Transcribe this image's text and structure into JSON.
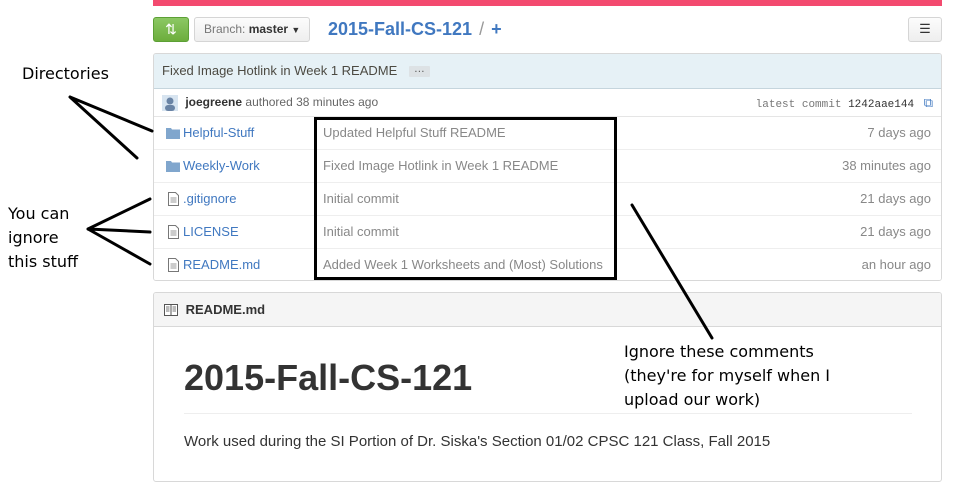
{
  "branch": {
    "label": "Branch:",
    "name": "master"
  },
  "repo": {
    "name": "2015-Fall-CS-121",
    "separator": "/",
    "add": "+"
  },
  "commit": {
    "title": "Fixed Image Hotlink in Week 1 README",
    "ellipsis": "…",
    "author": "joegreene",
    "authored_text": "authored 38 minutes ago",
    "latest_label": "latest commit",
    "sha": "1242aae144"
  },
  "files": [
    {
      "type": "dir",
      "name": "Helpful-Stuff",
      "message": "Updated Helpful Stuff README",
      "age": "7 days ago"
    },
    {
      "type": "dir",
      "name": "Weekly-Work",
      "message": "Fixed Image Hotlink in Week 1 README",
      "age": "38 minutes ago"
    },
    {
      "type": "file",
      "name": ".gitignore",
      "message": "Initial commit",
      "age": "21 days ago"
    },
    {
      "type": "file",
      "name": "LICENSE",
      "message": "Initial commit",
      "age": "21 days ago"
    },
    {
      "type": "file",
      "name": "README.md",
      "message": "Added Week 1 Worksheets and (Most) Solutions",
      "age": "an hour ago"
    }
  ],
  "readme": {
    "filename": "README.md",
    "heading": "2015-Fall-CS-121",
    "paragraph": "Work used during the SI Portion of Dr. Siska's Section 01/02 CPSC 121 Class, Fall 2015"
  },
  "annotations": {
    "directories": "Directories",
    "ignore_stuff": [
      "You can",
      "ignore",
      "this stuff"
    ],
    "ignore_comments": [
      "Ignore these comments",
      "(they're for myself when I",
      "upload our work)"
    ]
  },
  "colors": {
    "accent": "#4078c0",
    "topbar": "#f34a6f",
    "compare": "#6cad3c",
    "commit_bg": "#e6f1f6"
  }
}
